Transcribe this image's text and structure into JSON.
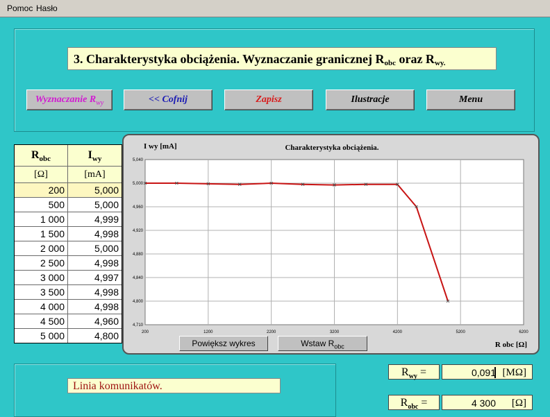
{
  "menu": {
    "pomoc": "Pomoc",
    "haslo": "Hasło"
  },
  "title": {
    "main": "3. Charakterystyka obciążenia. Wyznaczanie granicznej R",
    "sub1": "obc",
    "mid": " oraz R",
    "sub2": "wy."
  },
  "buttons": {
    "wyznaczanie": {
      "label": "Wyznaczanie R",
      "sub": "wy",
      "color": "#d11ad1"
    },
    "cofnij": {
      "label": "<< Cofnij",
      "color": "#1a1ab4"
    },
    "zapisz": {
      "label": "Zapisz",
      "color": "#d81a1a"
    },
    "ilustracje": {
      "label": "Ilustracje",
      "color": "#000000"
    },
    "menu": {
      "label": "Menu",
      "color": "#000000"
    }
  },
  "table": {
    "col1_header": "R",
    "col1_header_sub": "obc",
    "col1_unit": "[Ω]",
    "col2_header": "I",
    "col2_header_sub": "wy",
    "col2_unit": "[mA]",
    "rows": [
      [
        "200",
        "5,000"
      ],
      [
        "500",
        "5,000"
      ],
      [
        "1 000",
        "4,999"
      ],
      [
        "1 500",
        "4,998"
      ],
      [
        "2 000",
        "5,000"
      ],
      [
        "2 500",
        "4,998"
      ],
      [
        "3 000",
        "4,997"
      ],
      [
        "3 500",
        "4,998"
      ],
      [
        "4 000",
        "4,998"
      ],
      [
        "4 500",
        "4,960"
      ],
      [
        "5 000",
        "4,800"
      ]
    ]
  },
  "chart_data": {
    "type": "line",
    "title": "Charakterystyka obciążenia.",
    "ylabel": "I wy [mA]",
    "xlabel": "R obc [Ω]",
    "x": [
      200,
      700,
      1200,
      1700,
      2200,
      2700,
      3200,
      3700,
      4200,
      4500,
      5000
    ],
    "y": [
      5.0,
      5.0,
      4.999,
      4.998,
      5.0,
      4.998,
      4.997,
      4.998,
      4.998,
      4.96,
      4.8
    ],
    "xlim": [
      200,
      6200
    ],
    "ylim": [
      4.71,
      5.04
    ],
    "xticks": [
      "200",
      "1200",
      "2200",
      "3200",
      "4200",
      "5200",
      "6200"
    ],
    "yticks": [
      "5,040",
      "5,000",
      "4,960",
      "4,920",
      "4,880",
      "4,840",
      "4,800",
      "4,710"
    ],
    "grid": true,
    "color": "#c81414"
  },
  "chart_buttons": {
    "powieksz": "Powiększ wykres",
    "wstaw": "Wstaw R",
    "wstaw_sub": "obc"
  },
  "message": "Linia komunikatów.",
  "results": {
    "rwy_label": "R",
    "rwy_sub": "wy",
    "rwy_eq": " =",
    "rwy_value": "0,091",
    "rwy_unit": "[MΩ]",
    "robc_label": "R",
    "robc_sub": "obc",
    "robc_eq": " =",
    "robc_value": "4 300",
    "robc_unit": "[Ω]"
  }
}
